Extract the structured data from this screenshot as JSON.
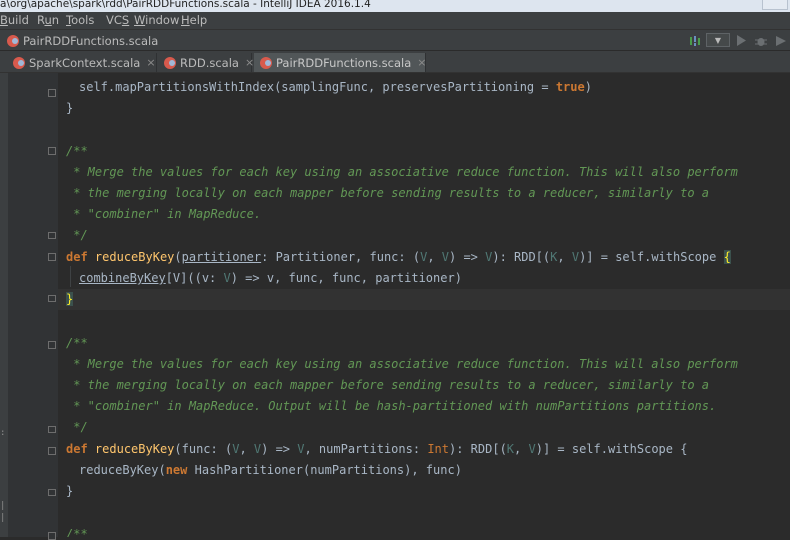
{
  "window": {
    "title": "a\\org\\apache\\spark\\rdd\\PairRDDFunctions.scala - IntelliJ IDEA 2016.1.4"
  },
  "menu": {
    "items": [
      {
        "pre": "",
        "mn": "B",
        "post": "uild"
      },
      {
        "pre": "R",
        "mn": "u",
        "post": "n"
      },
      {
        "pre": "",
        "mn": "T",
        "post": "ools"
      },
      {
        "pre": "VC",
        "mn": "S",
        "post": ""
      },
      {
        "pre": "",
        "mn": "W",
        "post": "indow"
      },
      {
        "pre": "",
        "mn": "H",
        "post": "elp"
      }
    ]
  },
  "navbar": {
    "breadcrumb": "PairRDDFunctions.scala"
  },
  "tabs": [
    {
      "label": "SparkContext.scala",
      "close": "×",
      "active": false
    },
    {
      "label": "RDD.scala",
      "close": "×",
      "active": false
    },
    {
      "label": "PairRDDFunctions.scala",
      "close": "×",
      "active": true
    }
  ],
  "code": {
    "l1": {
      "a": "self.mapPartitionsWithIndex(samplingFunc, preservesPartitioning = ",
      "b": "true",
      "c": ")"
    },
    "l2": "}",
    "doc1": {
      "open": "/**",
      "line1": " * Merge the values for each key using an associative reduce function. This will also perform",
      "line2": " * the merging locally on each mapper before sending results to a reducer, similarly to a",
      "line3": " * \"combiner\" in MapReduce.",
      "close": " */"
    },
    "def1": {
      "kw": "def",
      "name": "reduceByKey",
      "p1": "(",
      "p2": "partitioner",
      "p3": ": Partitioner, func: (",
      "tv1": "V",
      "p4": ", ",
      "tv2": "V",
      "p5": ") => ",
      "tv3": "V",
      "p6": "): RDD[(",
      "tv4": "K",
      "p7": ", ",
      "tv5": "V",
      "p8": ")] = self.withScope ",
      "brace": "{"
    },
    "body1": {
      "link": "combineByKey",
      "a": "[V]((v: ",
      "tv": "V",
      "b": ") => v, func, func, partitioner)"
    },
    "close1": "}",
    "doc2": {
      "open": "/**",
      "line1": " * Merge the values for each key using an associative reduce function. This will also perform",
      "line2": " * the merging locally on each mapper before sending results to a reducer, similarly to a",
      "line3": " * \"combiner\" in MapReduce. Output will be hash-partitioned with numPartitions partitions.",
      "close": " */"
    },
    "def2": {
      "kw": "def",
      "name": "reduceByKey",
      "a": "(func: (",
      "tv1": "V",
      "b": ", ",
      "tv2": "V",
      "c": ") => ",
      "tv3": "V",
      "d": ", numPartitions: ",
      "intT": "Int",
      "e": "): RDD[(",
      "tv4": "K",
      "f": ", ",
      "tv5": "V",
      "g": ")] = self.withScope {"
    },
    "body2": {
      "a": "reduceByKey(",
      "kw": "new",
      "b": " HashPartitioner(numPartitions), func)"
    },
    "close2": "}",
    "doc3": "/**"
  },
  "colors": {
    "keyword": "#cc7832",
    "function": "#ffc66d",
    "doc": "#629755",
    "typeParam": "#507874",
    "background": "#2b2b2b"
  }
}
